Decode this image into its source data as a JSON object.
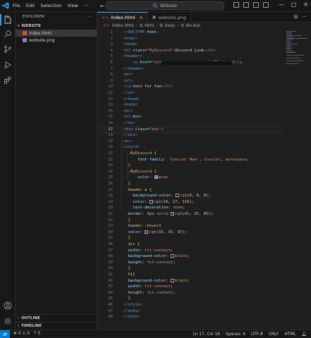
{
  "menu": [
    "File",
    "Edit",
    "Selection",
    "View"
  ],
  "more_label": "···",
  "nav": {
    "back": "←",
    "forward": "→"
  },
  "search": {
    "text": "Website"
  },
  "window": {
    "minimize": "—",
    "maximize": "□",
    "close": "✕"
  },
  "sidebar": {
    "title": "EXPLORER",
    "more": "···",
    "folder": "WEBSITE",
    "files": [
      {
        "name": "index.html",
        "selected": true
      },
      {
        "name": "website.png",
        "selected": false
      }
    ],
    "outline": "OUTLINE",
    "timeline": "TIMELINE"
  },
  "tabs": [
    {
      "label": "index.html",
      "active": true,
      "close": "×"
    },
    {
      "label": "website.png",
      "active": false
    }
  ],
  "tab_actions": {
    "split": "⊟",
    "more": "···"
  },
  "breadcrumb": [
    "index.html",
    "html",
    "body",
    "div.box"
  ],
  "cursor_line": 17,
  "status": {
    "errors": "0",
    "warnings": "0",
    "ports": "0",
    "position": "Ln 17, Col 18",
    "spaces": "Spaces: 4",
    "encoding": "UTF-8",
    "eol": "CRLF",
    "language": "HTML"
  },
  "icons": {
    "explorer": "files-icon",
    "search": "search-icon",
    "scm": "source-control-icon",
    "debug": "run-debug-icon",
    "extensions": "extensions-icon",
    "account": "account-icon",
    "manage": "gear-icon",
    "bell": "bell-icon"
  },
  "colors": {
    "accent": "#0078d4",
    "html_file": "#e44d26",
    "png_file": "#a074c4"
  }
}
